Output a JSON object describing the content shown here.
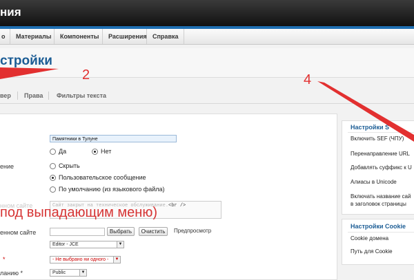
{
  "header": {
    "title": "ния"
  },
  "menu": {
    "items": [
      "о",
      "Материалы",
      "Компоненты",
      "Расширения",
      "Справка"
    ]
  },
  "page": {
    "title": "стройки"
  },
  "tabs": [
    "вер",
    "Права",
    "Фильтры текста"
  ],
  "form": {
    "site_name_value": "Памятники в Тулуне",
    "radio_yes": "Да",
    "radio_no": "Нет",
    "offline_label": "ение",
    "opt_hide": "Скрыть",
    "opt_custom": "Пользовательское сообщение",
    "opt_default": "По умолчанию (из языкового файла)",
    "offline_msg_label": "нном сайте",
    "offline_msg_text": "Сайт закрыт на техническое обслуживание.",
    "offline_msg_tag": "<br />",
    "annotation": "под выпадающим меню)",
    "image_label": "енном сайте",
    "btn_select": "Выбрать",
    "btn_clear": "Очистить",
    "preview_label": "Предпросмотр",
    "editor_value": "Editor - JCE",
    "captcha_label": "*",
    "captcha_value": "- Не выбрано ни одного -",
    "access_label": "ланию *",
    "access_value": "Public"
  },
  "seo": {
    "title": "Настройки S",
    "items": [
      "Включить SEF (ЧПУ)",
      "Перенаправление URL",
      "Добавлять суффикс к U",
      "Алиасы в Unicode",
      "Включать название сай",
      "в заголовок страницы"
    ]
  },
  "cookie": {
    "title": "Настройки Cookie",
    "items": [
      "Cookie домена",
      "Путь для Cookie"
    ]
  },
  "annotations": {
    "two": "2",
    "four": "4"
  },
  "colors": {
    "accent": "#1c5d95",
    "stripe": "#1f6fb2",
    "annotation": "#e23030"
  }
}
